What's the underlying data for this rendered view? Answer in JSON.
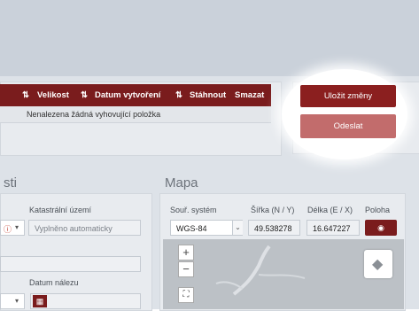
{
  "table": {
    "headers": [
      {
        "label": "Velikost",
        "sort": "⇅"
      },
      {
        "label": "Datum vytvoření",
        "sort": "⇅"
      },
      {
        "label": "Stáhnout",
        "sort": "⇅"
      },
      {
        "label": "Smazat",
        "sort": ""
      }
    ],
    "leading_sort": "⇅",
    "empty_message": "Nenalezena žádná vyhovující položka"
  },
  "actions": {
    "save_label": "Uložit změny",
    "send_label": "Odeslat"
  },
  "sections": {
    "left_title": "sti",
    "map_title": "Mapa"
  },
  "left_form": {
    "cadastre_label": "Katastrální území",
    "cadastre_placeholder": "Vyplněno automaticky",
    "find_date_label": "Datum nálezu"
  },
  "map_form": {
    "coord_system_label": "Souř. systém",
    "coord_system_value": "WGS-84",
    "lat_label": "Šířka (N / Y)",
    "lat_value": "49.538278",
    "lon_label": "Délka (E / X)",
    "lon_value": "16.647227",
    "position_label": "Poloha"
  },
  "map_controls": {
    "zoom_in": "+",
    "zoom_out": "−"
  },
  "colors": {
    "header_bg": "#7a1c1d",
    "save_bg": "#8b1f1f",
    "send_bg": "#c26c6c"
  }
}
